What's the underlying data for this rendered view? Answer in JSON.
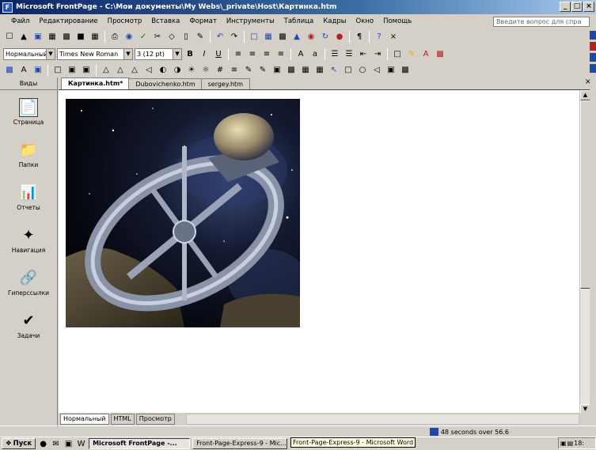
{
  "window": {
    "title": "Microsoft FrontPage - C:\\Мои документы\\My Webs\\_private\\Host\\Картинка.htm",
    "buttons": [
      "_",
      "□",
      "×"
    ]
  },
  "menubar": {
    "items": [
      "Файл",
      "Редактирование",
      "Просмотр",
      "Вставка",
      "Формат",
      "Инструменты",
      "Таблица",
      "Кадры",
      "Окно",
      "Помощь"
    ],
    "ask_placeholder": "Введите вопрос для спра"
  },
  "format_toolbar": {
    "style_value": "Нормальный",
    "font_value": "Times New Roman",
    "size_value": "3 (12 pt)",
    "bold": "B",
    "italic": "I",
    "underline": "U"
  },
  "views": {
    "header": "Виды",
    "items": [
      {
        "label": "Страница",
        "icon": "page-view-icon",
        "glyph": "📄"
      },
      {
        "label": "Папки",
        "icon": "folders-icon",
        "glyph": "📁"
      },
      {
        "label": "Отчеты",
        "icon": "reports-icon",
        "glyph": "📊"
      },
      {
        "label": "Навигация",
        "icon": "navigation-icon",
        "glyph": "✦"
      },
      {
        "label": "Гиперссылки",
        "icon": "hyperlinks-icon",
        "glyph": "🔗"
      },
      {
        "label": "Задачи",
        "icon": "tasks-icon",
        "glyph": "✔"
      }
    ]
  },
  "doc_tabs": [
    "Картинка.htm*",
    "Dubovichenko.htm",
    "sergey.htm"
  ],
  "close_x": "×",
  "view_tabs": [
    "Нормальный",
    "HTML",
    "Просмотр"
  ],
  "status": {
    "download_time": "48 seconds over 56.6"
  },
  "taskbar": {
    "start": "Пуск",
    "tasks": [
      "Microsoft FrontPage -...",
      "Front-Page-Express-9 - Mic..."
    ],
    "tooltip": "Front-Page-Express-9 - Microsoft Word",
    "clock": "18:"
  },
  "colors": {
    "title_start": "#0a246a",
    "title_end": "#a6caf0",
    "chrome": "#d4d0c8"
  }
}
